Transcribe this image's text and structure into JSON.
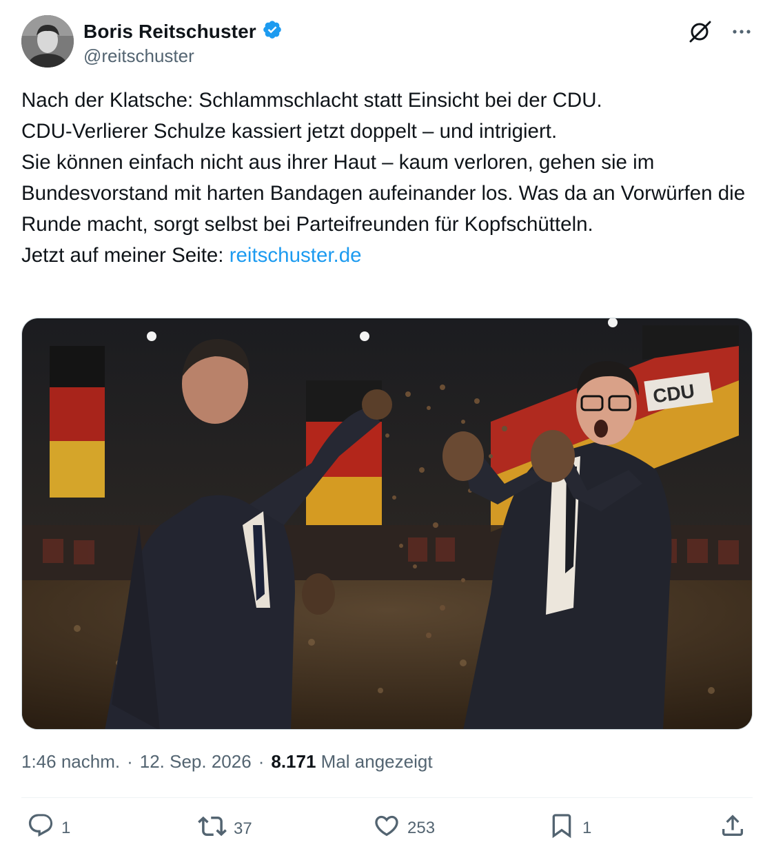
{
  "author": {
    "name": "Boris Reitschuster",
    "handle": "@reitschuster",
    "verified": true,
    "verified_color": "#1d9bf0"
  },
  "header_icons": [
    "grok-icon",
    "more-icon"
  ],
  "tweet": {
    "text_lines": [
      "Nach der Klatsche: Schlammschlacht statt Einsicht bei der CDU.",
      "CDU-Verlierer Schulze kassiert jetzt doppelt – und intrigiert.",
      "Sie können einfach nicht aus ihrer Haut – kaum verloren, gehen sie im Bundesvorstand mit harten Bandagen aufeinander los. Was da an Vorwürfen die Runde macht, sorgt selbst bei Parteifreunden für Kopfschütteln."
    ],
    "link_prefix": "Jetzt auf meiner Seite: ",
    "link_text": "reitschuster.de",
    "link_color": "#1d9bf0"
  },
  "media": {
    "banner_text": "CDU"
  },
  "meta": {
    "time": "1:46 nachm.",
    "separator": "·",
    "date": "12. Sep. 2026",
    "views_count": "8.171",
    "views_label": "Mal angezeigt"
  },
  "actions": {
    "replies": "1",
    "reposts": "37",
    "likes": "253",
    "bookmarks": "1"
  }
}
